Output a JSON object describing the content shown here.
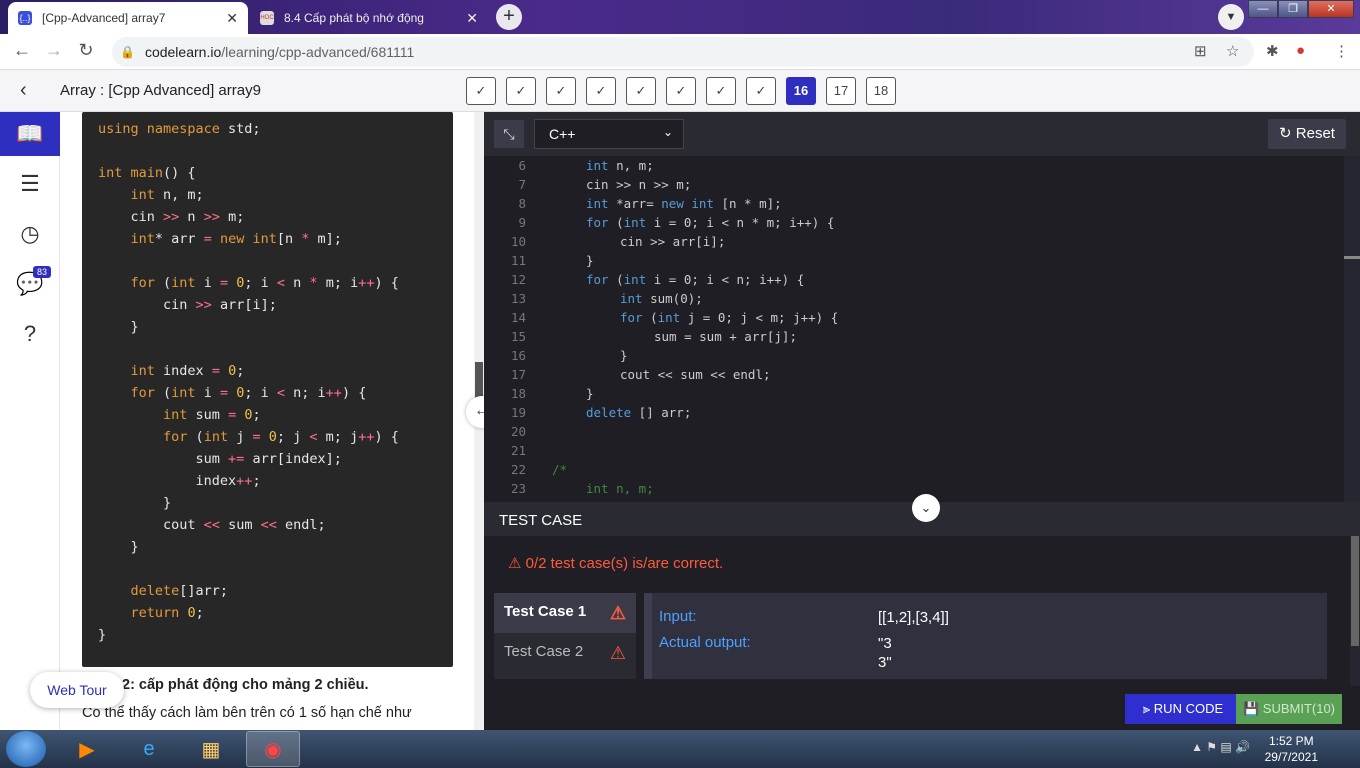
{
  "browser": {
    "tabs": [
      {
        "title": "[Cpp-Advanced] array7",
        "icon": "{..}"
      },
      {
        "title": "8.4 Cấp phát bộ nhớ động",
        "icon": "HOC"
      }
    ],
    "url_host": "codelearn.io",
    "url_path": "/learning/cpp-advanced/681111"
  },
  "header": {
    "breadcrumb": "Array : [Cpp Advanced] array9",
    "steps": [
      "16",
      "17",
      "18"
    ]
  },
  "sidebar": {
    "badge": "83"
  },
  "lesson": {
    "text_bold": "2: cấp phát động cho mảng 2 chiều.",
    "text_line": "Có thể thấy cách làm bên trên có 1 số hạn chế như",
    "webtour": "Web Tour"
  },
  "editor": {
    "language": "C++",
    "reset": "Reset",
    "line_numbers": [
      "6",
      "7",
      "8",
      "9",
      "10",
      "11",
      "12",
      "13",
      "14",
      "15",
      "16",
      "17",
      "18",
      "19",
      "20",
      "21",
      "22",
      "23"
    ]
  },
  "testcase": {
    "heading": "TEST CASE",
    "status": "0/2  test case(s) is/are correct.",
    "cases": [
      "Test Case 1",
      "Test Case 2"
    ],
    "input_label": "Input:",
    "input_value": "[[1,2],[3,4]]",
    "output_label": "Actual output:",
    "output_value": "\"3\n3\""
  },
  "buttons": {
    "run": "RUN CODE",
    "submit": "SUBMIT(10)"
  },
  "taskbar": {
    "time": "1:52 PM",
    "date": "29/7/2021"
  }
}
